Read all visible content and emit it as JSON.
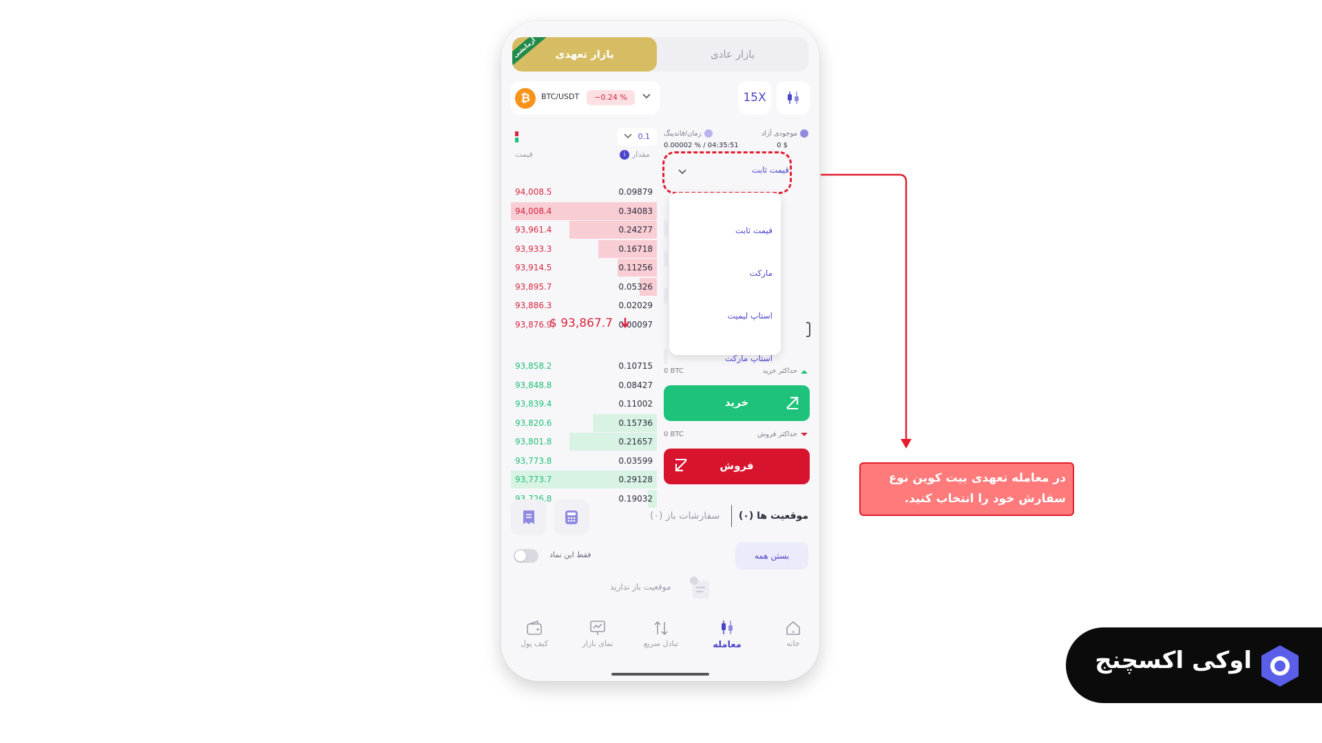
{
  "tabs": {
    "normal": "بازار عادی",
    "futures": "بازار تعهدی",
    "ribbon": "آزمایشی"
  },
  "pair": {
    "name": "BTC/USDT",
    "change": "−0.24 %",
    "coin_symbol": "₿",
    "leverage": "15X"
  },
  "orderbook": {
    "size_select": "0.1",
    "price_header": "قیمت",
    "amount_header": "مقدار",
    "asks": [
      {
        "price": "94,008.5",
        "amount": "0.09879",
        "depth": 0.0
      },
      {
        "price": "94,008.4",
        "amount": "0.34083",
        "depth": 1.0
      },
      {
        "price": "93,961.4",
        "amount": "0.24277",
        "depth": 0.6
      },
      {
        "price": "93,933.3",
        "amount": "0.16718",
        "depth": 0.4
      },
      {
        "price": "93,914.5",
        "amount": "0.11256",
        "depth": 0.27
      },
      {
        "price": "93,895.7",
        "amount": "0.05326",
        "depth": 0.12
      },
      {
        "price": "93,886.3",
        "amount": "0.02029",
        "depth": 0.0
      },
      {
        "price": "93,876.9",
        "amount": "0.00097",
        "depth": 0.0
      }
    ],
    "last_price": "$ 93,867.7",
    "bids": [
      {
        "price": "93,858.2",
        "amount": "0.10715",
        "depth": 0.0
      },
      {
        "price": "93,848.8",
        "amount": "0.08427",
        "depth": 0.0
      },
      {
        "price": "93,839.4",
        "amount": "0.11002",
        "depth": 0.0
      },
      {
        "price": "93,820.6",
        "amount": "0.15736",
        "depth": 0.44
      },
      {
        "price": "93,801.8",
        "amount": "0.21657",
        "depth": 0.6
      },
      {
        "price": "93,773.8",
        "amount": "0.03599",
        "depth": 0.0
      },
      {
        "price": "93,773.7",
        "amount": "0.29128",
        "depth": 1.0
      },
      {
        "price": "93,726.8",
        "amount": "0.19032",
        "depth": 0.06
      }
    ]
  },
  "trade": {
    "free_balance_label": "موجودی آزاد",
    "free_balance_value": "0 $",
    "funding_label": "زمان/فاندینگ",
    "funding_value": "0.00002 % / 04:35:51",
    "order_type_selected": "قیمت ثابت",
    "order_types": [
      "قیمت ثابت",
      "مارکت",
      "استاپ لیمیت",
      "استاپ مارکت"
    ],
    "max_buy_label": "حداکثر خرید",
    "max_buy_value": "0 BTC",
    "buy_label": "خرید",
    "max_sell_label": "حداکثر فروش",
    "max_sell_value": "0 BTC",
    "sell_label": "فروش"
  },
  "positions": {
    "positions_tab": "موقعیت ها (۰)",
    "open_orders_tab": "سفارشات باز (۰)",
    "close_all": "بستن همه",
    "only_symbol": "فقط این نماد",
    "empty": "موقعیت باز ندارید"
  },
  "nav": {
    "home": "خانه",
    "trade": "معامله",
    "swap": "تبادل سریع",
    "market": "نمای بازار",
    "wallet": "کیف پول"
  },
  "annotation": {
    "line1": "در معامله تعهدی بیت کوین نوع",
    "line2": "سفارش خود را انتخاب کنید."
  },
  "brand": {
    "name": "اوکی اکسچنج"
  },
  "colors": {
    "accent": "#4a45c9",
    "buy": "#1ec27a",
    "sell": "#d7132e",
    "gold": "#d6bd63",
    "annotation": "#ff7a7a"
  }
}
